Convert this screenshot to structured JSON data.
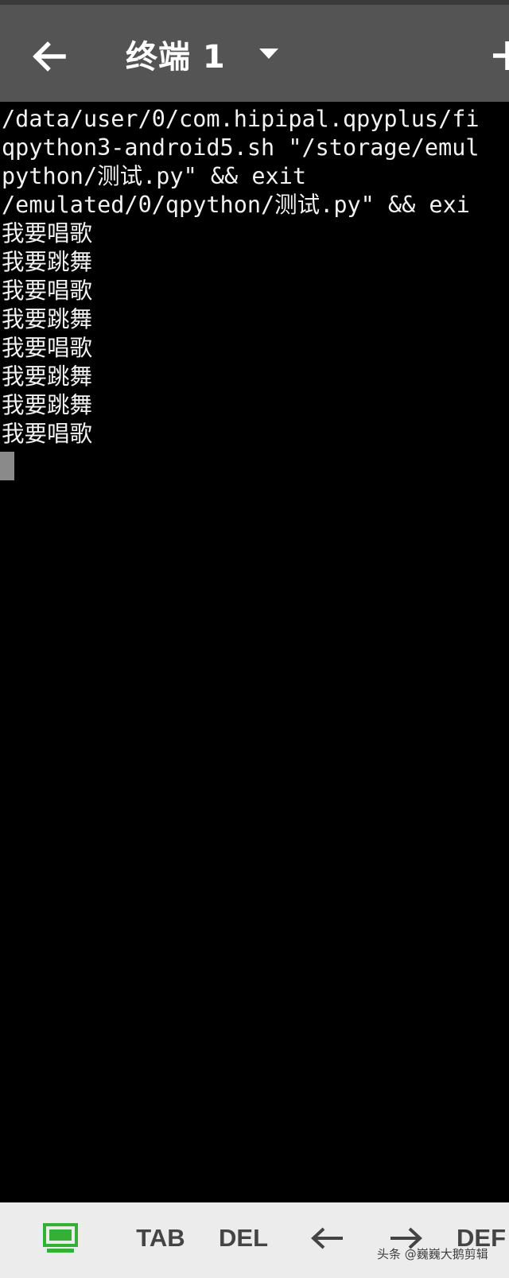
{
  "app_bar": {
    "title": "终端 1",
    "back_icon": "arrow-left-icon",
    "dropdown_icon": "caret-down-icon",
    "add_icon": "plus-icon",
    "background": "#545454"
  },
  "terminal": {
    "background": "#000000",
    "text_color": "#f2f2f2",
    "lines": [
      "/data/user/0/com.hipipal.qpyplus/fi",
      "qpython3-android5.sh \"/storage/emul",
      "python/测试.py\" && exit",
      "/emulated/0/qpython/测试.py\" && exi",
      "我要唱歌",
      "我要跳舞",
      "我要唱歌",
      "我要跳舞",
      "我要唱歌",
      "我要跳舞",
      "我要跳舞",
      "我要唱歌"
    ]
  },
  "extra_keys": {
    "keyboard_icon": "keyboard-toggle-icon",
    "keyboard_icon_color": "#35b035",
    "tab_label": "TAB",
    "del_label": "DEL",
    "left_arrow_icon": "arrow-left-icon",
    "right_arrow_icon": "arrow-right-icon",
    "def_label": "DEF"
  },
  "watermark": "头条 @巍巍大鹅剪辑"
}
